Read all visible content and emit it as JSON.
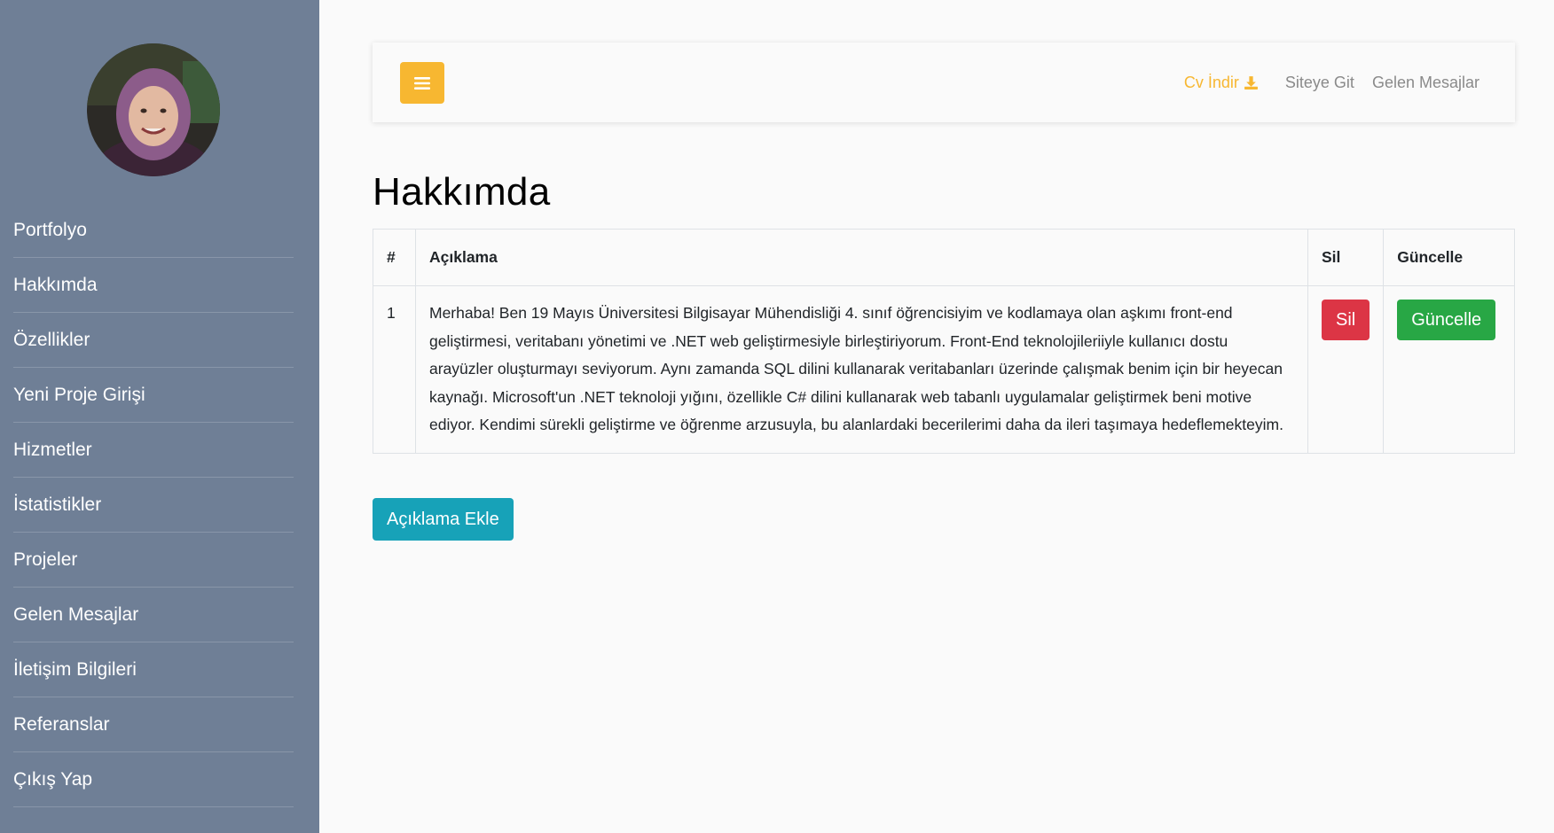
{
  "sidebar": {
    "items": [
      {
        "label": "Portfolyo"
      },
      {
        "label": "Hakkımda"
      },
      {
        "label": "Özellikler"
      },
      {
        "label": "Yeni Proje Girişi"
      },
      {
        "label": "Hizmetler"
      },
      {
        "label": "İstatistikler"
      },
      {
        "label": "Projeler"
      },
      {
        "label": "Gelen Mesajlar"
      },
      {
        "label": "İletişim Bilgileri"
      },
      {
        "label": "Referanslar"
      },
      {
        "label": "Çıkış Yap"
      }
    ]
  },
  "navbar": {
    "toggle_icon": "menu-icon",
    "cv_label": "Cv İndir",
    "cv_icon": "download-icon",
    "site_label": "Siteye Git",
    "messages_label": "Gelen Mesajlar"
  },
  "page": {
    "title": "Hakkımda"
  },
  "table": {
    "headers": {
      "num": "#",
      "desc": "Açıklama",
      "delete": "Sil",
      "update": "Güncelle"
    },
    "rows": [
      {
        "num": "1",
        "desc": "Merhaba! Ben 19 Mayıs Üniversitesi Bilgisayar Mühendisliği 4. sınıf öğrencisiyim ve kodlamaya olan aşkımı front-end geliştirmesi, veritabanı yönetimi ve .NET web geliştirmesiyle birleştiriyorum. Front-End teknolojileriiyle kullanıcı dostu arayüzler oluşturmayı seviyorum. Aynı zamanda SQL dilini kullanarak veritabanları üzerinde çalışmak benim için bir heyecan kaynağı. Microsoft'un .NET teknoloji yığını, özellikle C# dilini kullanarak web tabanlı uygulamalar geliştirmek beni motive ediyor. Kendimi sürekli geliştirme ve öğrenme arzusuyla, bu alanlardaki becerilerimi daha da ileri taşımaya hedeflemekteyim.",
        "delete_label": "Sil",
        "update_label": "Güncelle"
      }
    ]
  },
  "add_button_label": "Açıklama Ekle",
  "colors": {
    "sidebar_bg": "#6f7f96",
    "accent": "#f7b731",
    "danger": "#dc3545",
    "success": "#28a745",
    "info": "#17a2b8"
  }
}
